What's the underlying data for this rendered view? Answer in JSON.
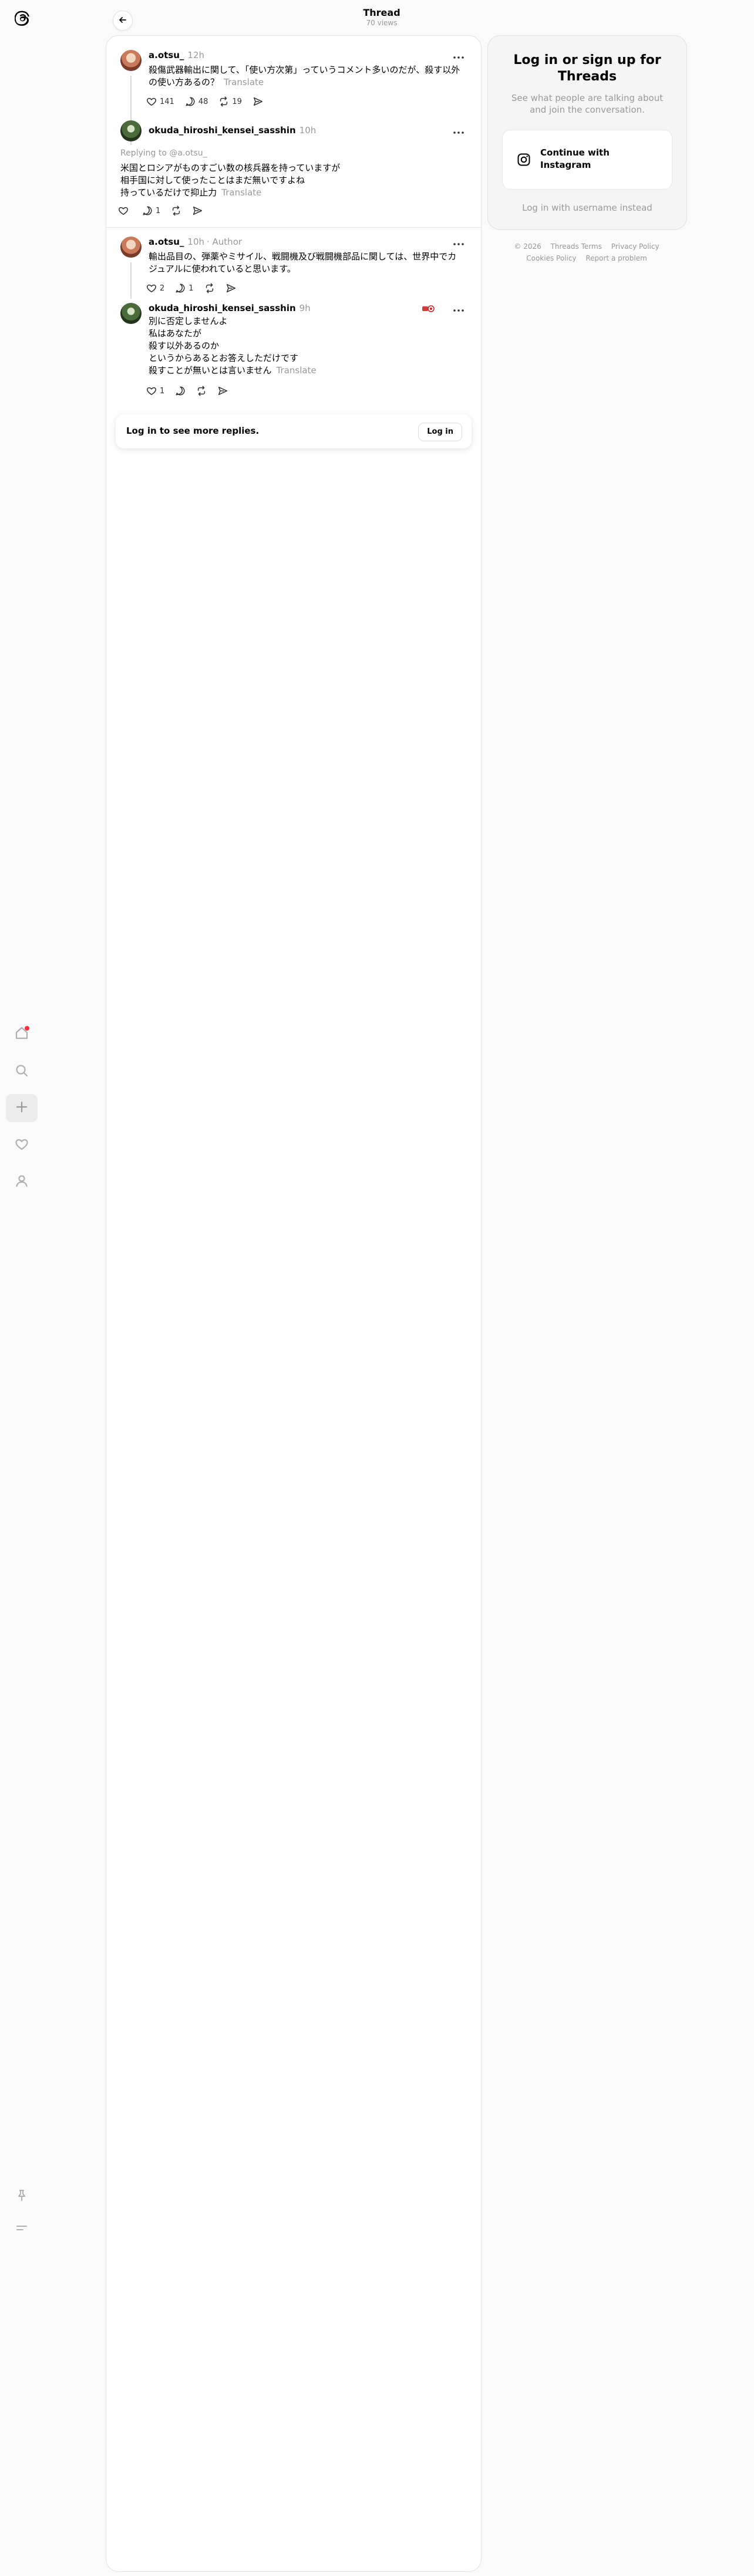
{
  "header": {
    "title": "Thread",
    "subtitle": "70 views"
  },
  "nav": [
    "home-icon",
    "search-icon",
    "create-icon",
    "heart-icon",
    "profile-icon",
    "pin-icon",
    "menu-icon"
  ],
  "posts": [
    {
      "user": "a.otsu_",
      "time": "12h",
      "text": "殺傷武器輸出に関して、「使い方次第」っていうコメント多いのだが、殺す以外の使い方あるの？",
      "translate": "Translate",
      "likes": "141",
      "replies": "48",
      "reposts": "19"
    },
    {
      "user": "okuda_hiroshi_kensei_sasshin",
      "time": "10h",
      "replying": "Replying to @a.otsu_",
      "lines": [
        "米国とロシアがものすごい数の核兵器を持っていますが",
        "相手国に対して使ったことはまだ無いですよね",
        "持っているだけで抑止力"
      ],
      "translate": "Translate",
      "likes": "",
      "replies": "1",
      "reposts": ""
    },
    {
      "user": "a.otsu_",
      "time": "10h",
      "author": "· Author",
      "text": "輸出品目の、弾薬やミサイル、戦闘機及び戦闘機部品に関しては、世界中でカジュアルに使われていると思います。",
      "likes": "2",
      "replies": "1",
      "reposts": ""
    },
    {
      "user": "okuda_hiroshi_kensei_sasshin",
      "time": "9h",
      "lines": [
        "別に否定しませんよ",
        "私はあなたが",
        "殺す以外あるのか",
        "というからあるとお答えしただけです",
        "殺すことが無いとは言いません"
      ],
      "translate": "Translate",
      "likes": "1",
      "replies": "",
      "reposts": ""
    }
  ],
  "login_bar": {
    "text": "Log in to see more replies.",
    "button": "Log in"
  },
  "right_card": {
    "title": "Log in or sign up for Threads",
    "subtitle": "See what people are talking about and join the conversation.",
    "ig_button": "Continue with Instagram",
    "alt": "Log in with username instead"
  },
  "footer": {
    "copyright": "© 2026",
    "terms": "Threads Terms",
    "privacy": "Privacy Policy",
    "cookies": "Cookies Policy",
    "report": "Report a problem"
  }
}
